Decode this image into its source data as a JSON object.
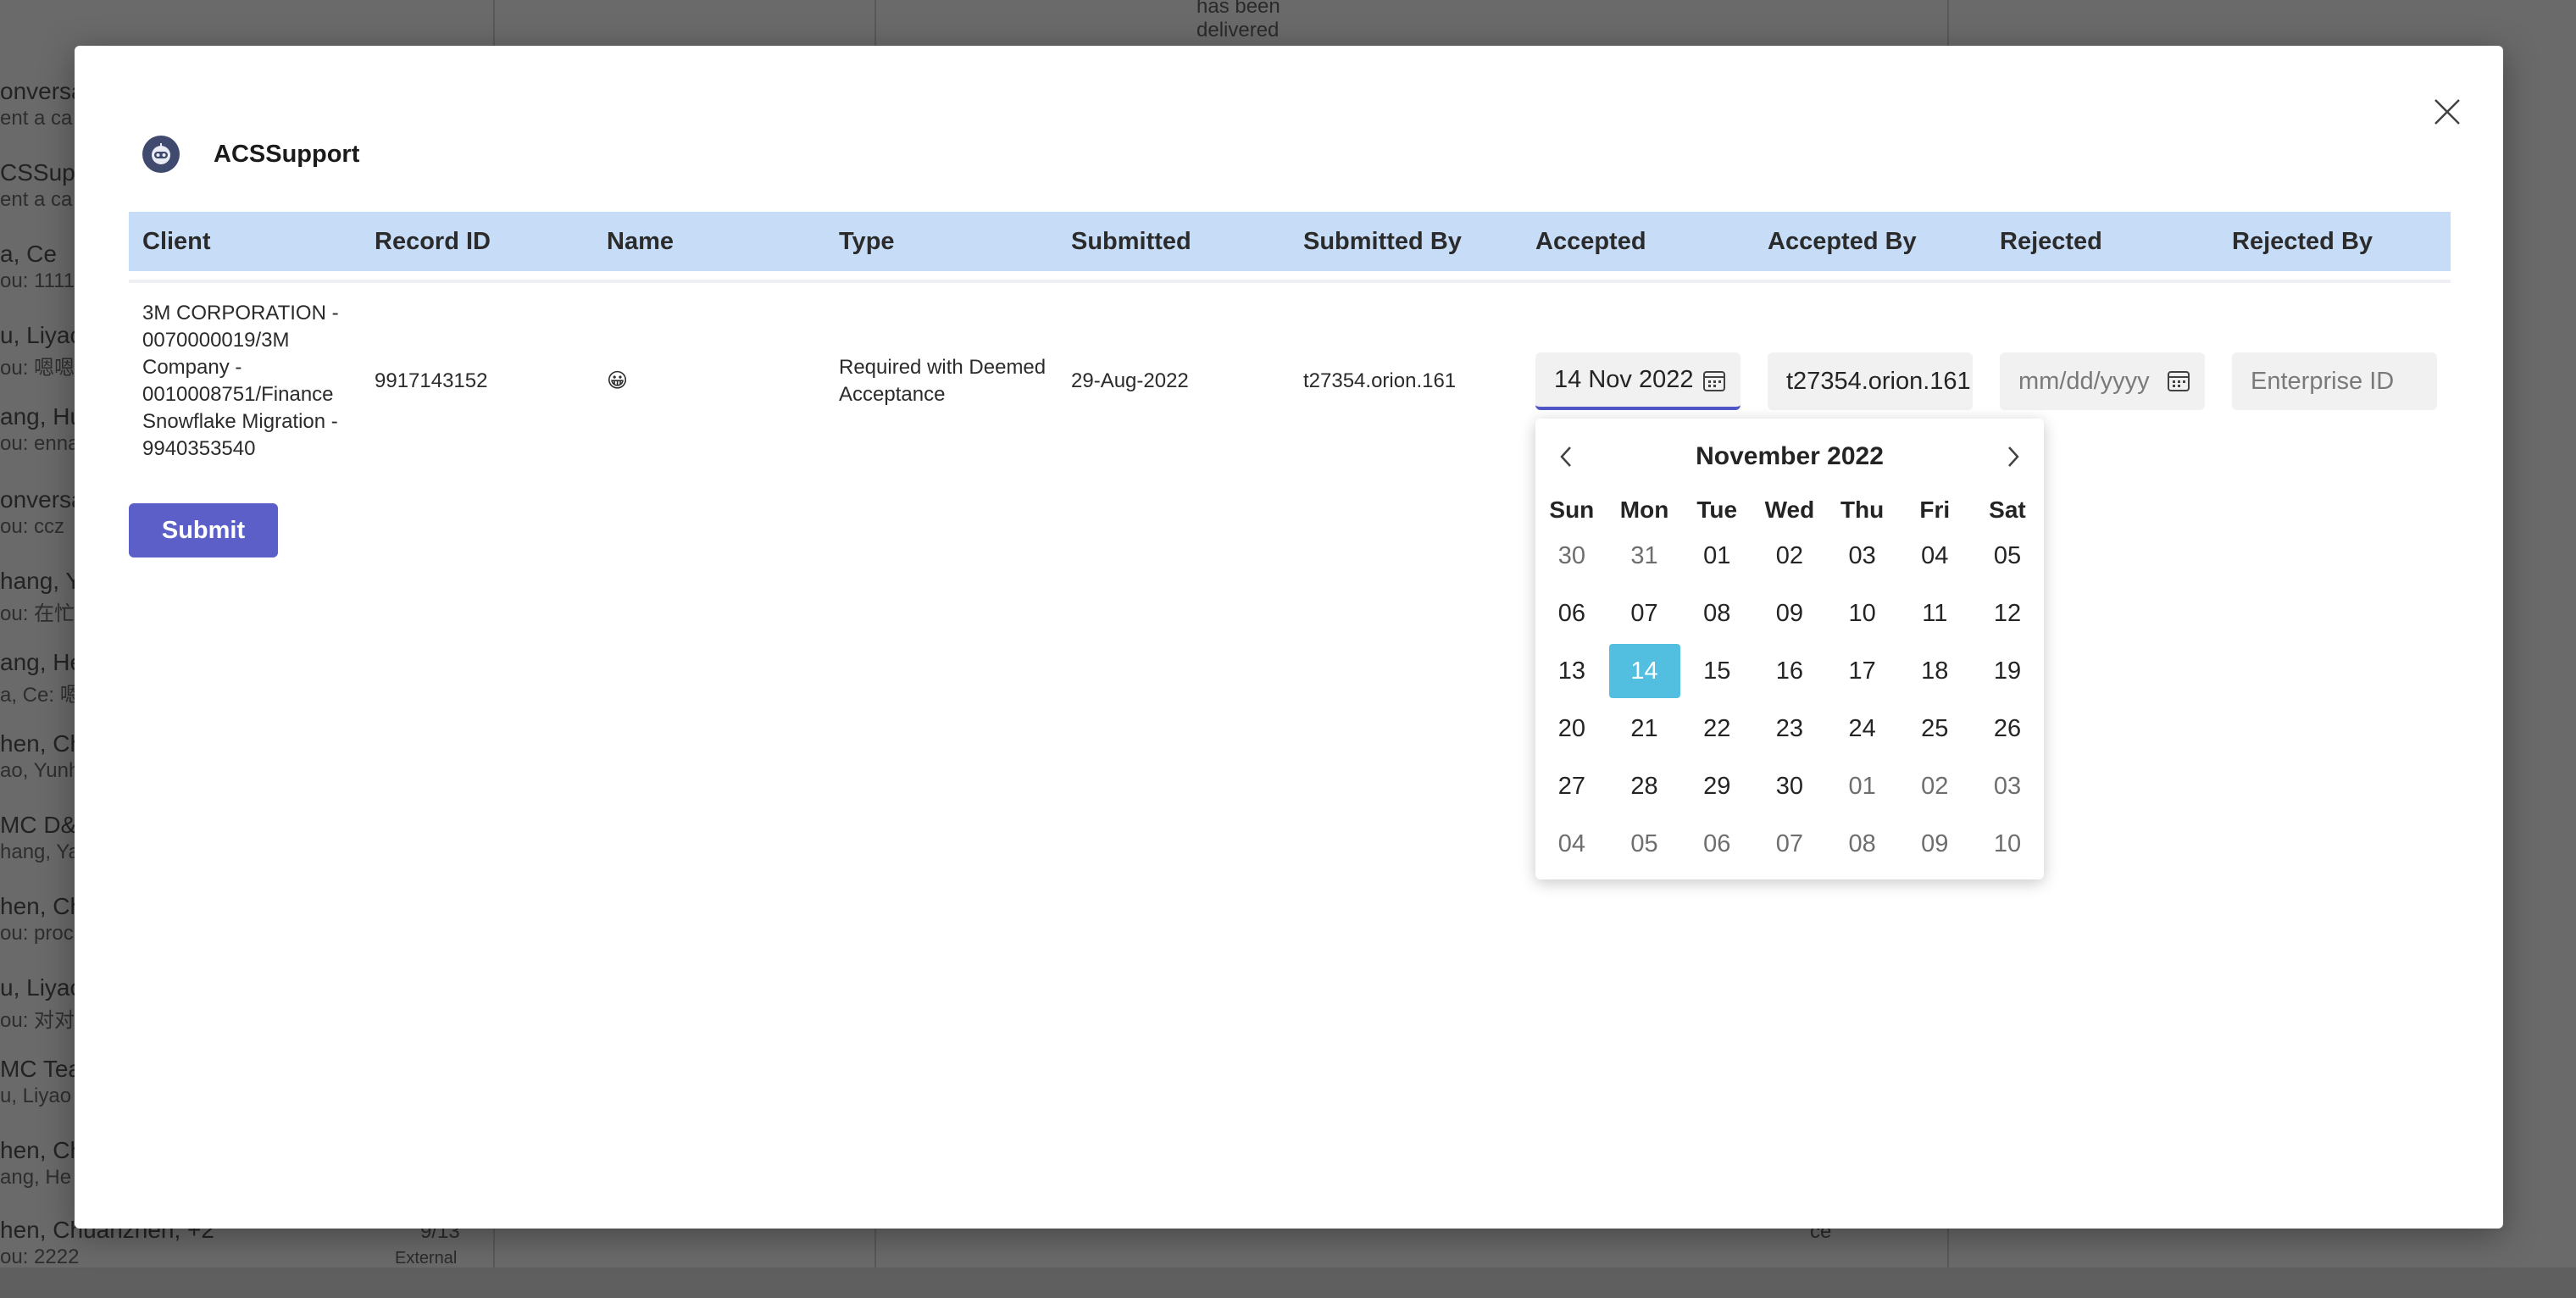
{
  "background": {
    "chats": [
      {
        "name": "onversa",
        "sub": "ent a ca"
      },
      {
        "name": "CSSupp",
        "sub": "ent a ca"
      },
      {
        "name": "a, Ce",
        "sub": "ou: 1111"
      },
      {
        "name": "u, Liyac",
        "sub": "ou: 嗯嗯"
      },
      {
        "name": "ang, Hu",
        "sub": "ou: enna"
      },
      {
        "name": "onversa",
        "sub": "ou: ccz"
      },
      {
        "name": "hang, Y",
        "sub": "ou: 在忙"
      },
      {
        "name": "ang, He",
        "sub": "a, Ce: 嗯"
      },
      {
        "name": "hen, Ch",
        "sub": "ao, Yunh"
      },
      {
        "name": "MC D&",
        "sub": "hang, Ya"
      },
      {
        "name": "hen, Ch",
        "sub": "ou: proc"
      },
      {
        "name": "u, Liyac",
        "sub": "ou: 对对"
      },
      {
        "name": "MC Tea",
        "sub": "u, Liyao"
      },
      {
        "name": "hen, Ch",
        "sub": "ang, He"
      },
      {
        "name": "hen, Chuanzhen, +2",
        "sub": "ou: 2222"
      }
    ],
    "last_chat_meta": {
      "date": "9/13",
      "tag": "External"
    },
    "message_snippet": [
      "has been",
      "delivered"
    ],
    "bottom_snippet": "ce"
  },
  "modal": {
    "close_icon": "close-icon",
    "app_name": "ACSSupport",
    "columns": [
      "Client",
      "Record ID",
      "Name",
      "Type",
      "Submitted",
      "Submitted By",
      "Accepted",
      "Accepted By",
      "Rejected",
      "Rejected By"
    ],
    "row": {
      "client": "3M CORPORATION - 0070000019/3M Company - 0010008751/Finance Snowflake Migration - 9940353540",
      "record_id": "9917143152",
      "name": "😀",
      "type": "Required with Deemed Acceptance",
      "submitted": "29-Aug-2022",
      "submitted_by": "t27354.orion.161",
      "accepted": "14 Nov 2022",
      "accepted_by": "t27354.orion.161",
      "rejected_placeholder": "mm/dd/yyyy",
      "rejected_by_placeholder": "Enterprise ID"
    },
    "submit_label": "Submit"
  },
  "datepicker": {
    "title": "November 2022",
    "weekdays": [
      "Sun",
      "Mon",
      "Tue",
      "Wed",
      "Thu",
      "Fri",
      "Sat"
    ],
    "days": [
      [
        "30",
        "31",
        "01",
        "02",
        "03",
        "04",
        "05"
      ],
      [
        "06",
        "07",
        "08",
        "09",
        "10",
        "11",
        "12"
      ],
      [
        "13",
        "14",
        "15",
        "16",
        "17",
        "18",
        "19"
      ],
      [
        "20",
        "21",
        "22",
        "23",
        "24",
        "25",
        "26"
      ],
      [
        "27",
        "28",
        "29",
        "30",
        "01",
        "02",
        "03"
      ],
      [
        "04",
        "05",
        "06",
        "07",
        "08",
        "09",
        "10"
      ]
    ],
    "out_of_month": [
      [
        true,
        true,
        false,
        false,
        false,
        false,
        false
      ],
      [
        false,
        false,
        false,
        false,
        false,
        false,
        false
      ],
      [
        false,
        false,
        false,
        false,
        false,
        false,
        false
      ],
      [
        false,
        false,
        false,
        false,
        false,
        false,
        false
      ],
      [
        false,
        false,
        false,
        false,
        true,
        true,
        true
      ],
      [
        true,
        true,
        true,
        true,
        true,
        true,
        true
      ]
    ],
    "selected": "14",
    "selected_color": "#52bfe0"
  },
  "colors": {
    "accent": "#5b5fc7",
    "header_bg": "#c7dcf7"
  }
}
